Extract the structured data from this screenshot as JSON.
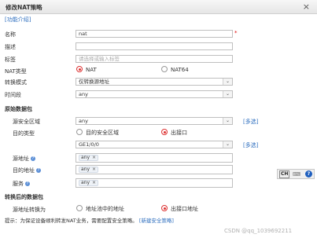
{
  "dialog": {
    "title": "修改NAT策略",
    "close_glyph": "×"
  },
  "func_intro": "[功能介绍]",
  "form": {
    "name_label": "名称",
    "name_value": "nat",
    "required_mark": "*",
    "desc_label": "描述",
    "desc_value": "",
    "tag_label": "标签",
    "tag_placeholder": "请选择或输入标签",
    "nat_type_label": "NAT类型",
    "nat_type_options": [
      "NAT",
      "NAT64"
    ],
    "nat_type_selected": "NAT",
    "convert_mode_label": "转换模式",
    "convert_mode_value": "仅转换源地址",
    "time_label": "时间段",
    "time_value": "any"
  },
  "original_packet": {
    "section_title": "原始数据包",
    "src_zone_label": "源安全区域",
    "src_zone_value": "any",
    "multi_select": "[多选]",
    "dst_type_label": "目的类型",
    "dst_type_options": [
      "目的安全区域",
      "出接口"
    ],
    "dst_type_selected": "出接口",
    "out_if_value": "GE1/0/0",
    "src_addr_label": "源地址",
    "src_addr_tag": "any",
    "dst_addr_label": "目的地址",
    "dst_addr_tag": "any",
    "service_label": "服务",
    "service_tag": "any",
    "help_glyph": "?",
    "tag_remove_glyph": "×"
  },
  "translated_packet": {
    "section_title": "转换后的数据包",
    "src_convert_label": "源地址转换为",
    "src_convert_options": [
      "地址池中的地址",
      "出接口地址"
    ],
    "src_convert_selected": "出接口地址"
  },
  "note": {
    "text": "提示：为保证设备顺利转发NAT业务，需要配置安全策略。",
    "link": "[新建安全策略]"
  },
  "ime": {
    "mode": "CH",
    "help": "?"
  },
  "watermark": "CSDN @qq_1039692211",
  "colors": {
    "link": "#2f6fbf",
    "radio_selected": "#d33333",
    "required": "#dd0000"
  }
}
